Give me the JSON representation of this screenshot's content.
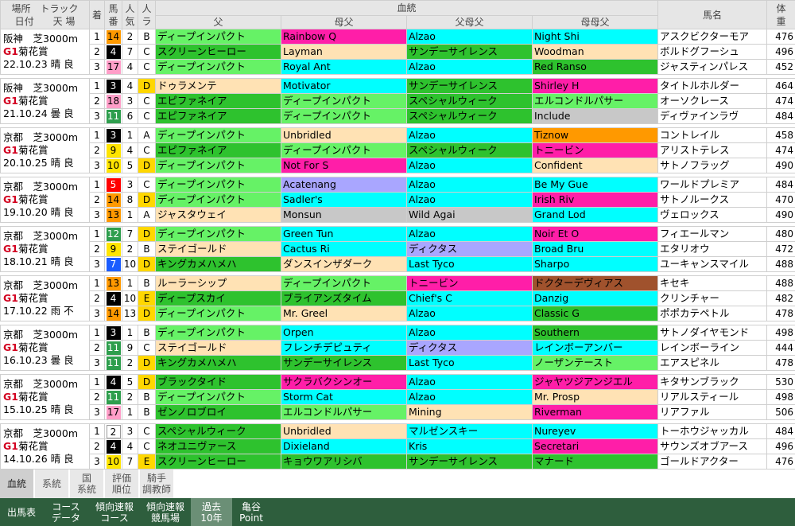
{
  "headers": {
    "place": "場所",
    "track": "トラック",
    "date": "日付",
    "weather_ground": "天 場",
    "finish": "着",
    "horse_no": "馬番",
    "popularity": "人気",
    "rank": "人ラ",
    "pedigree": "血統",
    "sire": "父",
    "damsire": "母父",
    "sire_sire": "父母父",
    "dam_dam_sire": "母母父",
    "horse_name": "馬名",
    "weight": "体重"
  },
  "colors": {
    "green": "#66f266",
    "dkgreen": "#2ec22e",
    "magenta": "#ff1ea8",
    "cyan": "#00ffff",
    "peach": "#ffe2b4",
    "purple": "#a9a6ff",
    "grey": "#c8c8c8",
    "orange": "#ff9900",
    "brown": "#a0522d",
    "frame_gray": "#bfbfbf"
  },
  "races": [
    {
      "place": "阪神",
      "track": "芝3000m",
      "grade": "G1",
      "race": "菊花賞",
      "date": "22.10.23",
      "weather": "晴",
      "ground": "良",
      "horses": [
        {
          "finish": "1",
          "no": "14",
          "frame": "orange",
          "pop": "2",
          "rank": "B",
          "sire": "ディープインパクト",
          "sire_c": "green",
          "dams": "Rainbow Q",
          "dams_c": "magenta",
          "ss": "Alzao",
          "ss_c": "cyan",
          "dds": "Night Shi",
          "dds_c": "cyan",
          "name": "アスクビクターモア",
          "weight": "476"
        },
        {
          "finish": "2",
          "no": "4",
          "frame": "black",
          "pop": "7",
          "rank": "C",
          "sire": "スクリーンヒーロー",
          "sire_c": "dkgreen",
          "dams": "Layman",
          "dams_c": "peach",
          "ss": "サンデーサイレンス",
          "ss_c": "dkgreen",
          "dds": "Woodman",
          "dds_c": "peach",
          "name": "ボルドグフーシュ",
          "weight": "496"
        },
        {
          "finish": "3",
          "no": "17",
          "frame": "pink",
          "pop": "4",
          "rank": "C",
          "sire": "ディープインパクト",
          "sire_c": "green",
          "dams": "Royal Ant",
          "dams_c": "cyan",
          "ss": "Alzao",
          "ss_c": "cyan",
          "dds": "Red Ranso",
          "dds_c": "dkgreen",
          "name": "ジャスティンパレス",
          "weight": "452"
        }
      ]
    },
    {
      "place": "阪神",
      "track": "芝3000m",
      "grade": "G1",
      "race": "菊花賞",
      "date": "21.10.24",
      "weather": "曇",
      "ground": "良",
      "horses": [
        {
          "finish": "1",
          "no": "3",
          "frame": "black",
          "pop": "4",
          "rank": "D",
          "sire": "ドゥラメンテ",
          "sire_c": "peach",
          "dams": "Motivator",
          "dams_c": "cyan",
          "ss": "サンデーサイレンス",
          "ss_c": "dkgreen",
          "dds": "Shirley H",
          "dds_c": "magenta",
          "name": "タイトルホルダー",
          "weight": "464"
        },
        {
          "finish": "2",
          "no": "18",
          "frame": "pink",
          "pop": "3",
          "rank": "C",
          "sire": "エピファネイア",
          "sire_c": "dkgreen",
          "dams": "ディープインパクト",
          "dams_c": "green",
          "ss": "スペシャルウィーク",
          "ss_c": "dkgreen",
          "dds": "エルコンドルパサー",
          "dds_c": "green",
          "name": "オーソクレース",
          "weight": "474"
        },
        {
          "finish": "3",
          "no": "11",
          "frame": "green",
          "pop": "6",
          "rank": "C",
          "sire": "エピファネイア",
          "sire_c": "dkgreen",
          "dams": "ディープインパクト",
          "dams_c": "green",
          "ss": "スペシャルウィーク",
          "ss_c": "dkgreen",
          "dds": "Include",
          "dds_c": "grey",
          "name": "ディヴァインラヴ",
          "weight": "484"
        }
      ]
    },
    {
      "place": "京都",
      "track": "芝3000m",
      "grade": "G1",
      "race": "菊花賞",
      "date": "20.10.25",
      "weather": "晴",
      "ground": "良",
      "horses": [
        {
          "finish": "1",
          "no": "3",
          "frame": "black",
          "pop": "1",
          "rank": "A",
          "sire": "ディープインパクト",
          "sire_c": "green",
          "dams": "Unbridled",
          "dams_c": "peach",
          "ss": "Alzao",
          "ss_c": "cyan",
          "dds": "Tiznow",
          "dds_c": "orange",
          "name": "コントレイル",
          "weight": "458"
        },
        {
          "finish": "2",
          "no": "9",
          "frame": "yellow",
          "pop": "4",
          "rank": "C",
          "sire": "エピファネイア",
          "sire_c": "dkgreen",
          "dams": "ディープインパクト",
          "dams_c": "green",
          "ss": "スペシャルウィーク",
          "ss_c": "dkgreen",
          "dds": "トニービン",
          "dds_c": "magenta",
          "name": "アリストテレス",
          "weight": "474"
        },
        {
          "finish": "3",
          "no": "10",
          "frame": "yellow",
          "pop": "5",
          "rank": "D",
          "sire": "ディープインパクト",
          "sire_c": "green",
          "dams": "Not For S",
          "dams_c": "magenta",
          "ss": "Alzao",
          "ss_c": "cyan",
          "dds": "Confident",
          "dds_c": "peach",
          "name": "サトノフラッグ",
          "weight": "490"
        }
      ]
    },
    {
      "place": "京都",
      "track": "芝3000m",
      "grade": "G1",
      "race": "菊花賞",
      "date": "19.10.20",
      "weather": "晴",
      "ground": "良",
      "horses": [
        {
          "finish": "1",
          "no": "5",
          "frame": "red",
          "pop": "3",
          "rank": "C",
          "sire": "ディープインパクト",
          "sire_c": "green",
          "dams": "Acatenang",
          "dams_c": "purple",
          "ss": "Alzao",
          "ss_c": "cyan",
          "dds": "Be My Gue",
          "dds_c": "cyan",
          "name": "ワールドプレミア",
          "weight": "484"
        },
        {
          "finish": "2",
          "no": "14",
          "frame": "orange",
          "pop": "8",
          "rank": "D",
          "sire": "ディープインパクト",
          "sire_c": "green",
          "dams": "Sadler's",
          "dams_c": "cyan",
          "ss": "Alzao",
          "ss_c": "cyan",
          "dds": "Irish Riv",
          "dds_c": "magenta",
          "name": "サトノルークス",
          "weight": "470"
        },
        {
          "finish": "3",
          "no": "13",
          "frame": "orange",
          "pop": "1",
          "rank": "A",
          "sire": "ジャスタウェイ",
          "sire_c": "peach",
          "dams": "Monsun",
          "dams_c": "grey",
          "ss": "Wild Agai",
          "ss_c": "grey",
          "dds": "Grand Lod",
          "dds_c": "cyan",
          "name": "ヴェロックス",
          "weight": "490"
        }
      ]
    },
    {
      "place": "京都",
      "track": "芝3000m",
      "grade": "G1",
      "race": "菊花賞",
      "date": "18.10.21",
      "weather": "晴",
      "ground": "良",
      "horses": [
        {
          "finish": "1",
          "no": "12",
          "frame": "green",
          "pop": "7",
          "rank": "D",
          "sire": "ディープインパクト",
          "sire_c": "green",
          "dams": "Green Tun",
          "dams_c": "cyan",
          "ss": "Alzao",
          "ss_c": "cyan",
          "dds": "Noir Et O",
          "dds_c": "magenta",
          "name": "フィエールマン",
          "weight": "480"
        },
        {
          "finish": "2",
          "no": "9",
          "frame": "yellow",
          "pop": "2",
          "rank": "B",
          "sire": "ステイゴールド",
          "sire_c": "peach",
          "dams": "Cactus Ri",
          "dams_c": "cyan",
          "ss": "ディクタス",
          "ss_c": "purple",
          "dds": "Broad Bru",
          "dds_c": "cyan",
          "name": "エタリオウ",
          "weight": "472"
        },
        {
          "finish": "3",
          "no": "7",
          "frame": "blue",
          "pop": "10",
          "rank": "D",
          "sire": "キングカメハメハ",
          "sire_c": "dkgreen",
          "dams": "ダンスインザダーク",
          "dams_c": "peach",
          "ss": "Last Tyco",
          "ss_c": "cyan",
          "dds": "Sharpo",
          "dds_c": "cyan",
          "name": "ユーキャンスマイル",
          "weight": "488"
        }
      ]
    },
    {
      "place": "京都",
      "track": "芝3000m",
      "grade": "G1",
      "race": "菊花賞",
      "date": "17.10.22",
      "weather": "雨",
      "ground": "不",
      "horses": [
        {
          "finish": "1",
          "no": "13",
          "frame": "orange",
          "pop": "1",
          "rank": "B",
          "sire": "ルーラーシップ",
          "sire_c": "peach",
          "dams": "ディープインパクト",
          "dams_c": "green",
          "ss": "トニービン",
          "ss_c": "magenta",
          "dds": "ドクターデヴィアス",
          "dds_c": "brown",
          "name": "キセキ",
          "weight": "488"
        },
        {
          "finish": "2",
          "no": "4",
          "frame": "black",
          "pop": "10",
          "rank": "E",
          "sire": "ディープスカイ",
          "sire_c": "dkgreen",
          "dams": "ブライアンズタイム",
          "dams_c": "dkgreen",
          "ss": "Chief's C",
          "ss_c": "cyan",
          "dds": "Danzig",
          "dds_c": "cyan",
          "name": "クリンチャー",
          "weight": "482"
        },
        {
          "finish": "3",
          "no": "14",
          "frame": "orange",
          "pop": "13",
          "rank": "D",
          "sire": "ディープインパクト",
          "sire_c": "green",
          "dams": "Mr. Greel",
          "dams_c": "peach",
          "ss": "Alzao",
          "ss_c": "cyan",
          "dds": "Classic G",
          "dds_c": "dkgreen",
          "name": "ポポカテペトル",
          "weight": "478"
        }
      ]
    },
    {
      "place": "京都",
      "track": "芝3000m",
      "grade": "G1",
      "race": "菊花賞",
      "date": "16.10.23",
      "weather": "曇",
      "ground": "良",
      "horses": [
        {
          "finish": "1",
          "no": "3",
          "frame": "black",
          "pop": "1",
          "rank": "B",
          "sire": "ディープインパクト",
          "sire_c": "green",
          "dams": "Orpen",
          "dams_c": "cyan",
          "ss": "Alzao",
          "ss_c": "cyan",
          "dds": "Southern",
          "dds_c": "dkgreen",
          "name": "サトノダイヤモンド",
          "weight": "498"
        },
        {
          "finish": "2",
          "no": "11",
          "frame": "green",
          "pop": "9",
          "rank": "C",
          "sire": "ステイゴールド",
          "sire_c": "peach",
          "dams": "フレンチデピュティ",
          "dams_c": "cyan",
          "ss": "ディクタス",
          "ss_c": "purple",
          "dds": "レインボーアンバー",
          "dds_c": "cyan",
          "name": "レインボーライン",
          "weight": "444"
        },
        {
          "finish": "3",
          "no": "11",
          "frame": "green",
          "pop": "2",
          "rank": "D",
          "sire": "キングカメハメハ",
          "sire_c": "dkgreen",
          "dams": "サンデーサイレンス",
          "dams_c": "dkgreen",
          "ss": "Last Tyco",
          "ss_c": "cyan",
          "dds": "ノーザンテースト",
          "dds_c": "green",
          "name": "エアスピネル",
          "weight": "478"
        }
      ]
    },
    {
      "place": "京都",
      "track": "芝3000m",
      "grade": "G1",
      "race": "菊花賞",
      "date": "15.10.25",
      "weather": "晴",
      "ground": "良",
      "horses": [
        {
          "finish": "1",
          "no": "4",
          "frame": "black",
          "pop": "5",
          "rank": "D",
          "sire": "ブラックタイド",
          "sire_c": "dkgreen",
          "dams": "サクラバクシンオー",
          "dams_c": "magenta",
          "ss": "Alzao",
          "ss_c": "cyan",
          "dds": "ジャヤツジアンジエル",
          "dds_c": "magenta",
          "name": "キタサンブラック",
          "weight": "530"
        },
        {
          "finish": "2",
          "no": "11",
          "frame": "green",
          "pop": "2",
          "rank": "B",
          "sire": "ディープインパクト",
          "sire_c": "green",
          "dams": "Storm Cat",
          "dams_c": "cyan",
          "ss": "Alzao",
          "ss_c": "cyan",
          "dds": "Mr. Prosp",
          "dds_c": "peach",
          "name": "リアルスティール",
          "weight": "498"
        },
        {
          "finish": "3",
          "no": "17",
          "frame": "pink",
          "pop": "1",
          "rank": "B",
          "sire": "ゼンノロブロイ",
          "sire_c": "dkgreen",
          "dams": "エルコンドルパサー",
          "dams_c": "green",
          "ss": "Mining",
          "ss_c": "peach",
          "dds": "Riverman",
          "dds_c": "magenta",
          "name": "リアファル",
          "weight": "506"
        }
      ]
    },
    {
      "place": "京都",
      "track": "芝3000m",
      "grade": "G1",
      "race": "菊花賞",
      "date": "14.10.26",
      "weather": "晴",
      "ground": "良",
      "horses": [
        {
          "finish": "1",
          "no": "2",
          "frame": "white",
          "pop": "3",
          "rank": "C",
          "sire": "スペシャルウィーク",
          "sire_c": "dkgreen",
          "dams": "Unbridled",
          "dams_c": "peach",
          "ss": "マルゼンスキー",
          "ss_c": "cyan",
          "dds": "Nureyev",
          "dds_c": "cyan",
          "name": "トーホウジャッカル",
          "weight": "484"
        },
        {
          "finish": "2",
          "no": "4",
          "frame": "black",
          "pop": "4",
          "rank": "C",
          "sire": "ネオユニヴァース",
          "sire_c": "dkgreen",
          "dams": "Dixieland",
          "dams_c": "cyan",
          "ss": "Kris",
          "ss_c": "cyan",
          "dds": "Secretari",
          "dds_c": "magenta",
          "name": "サウンズオブアース",
          "weight": "496"
        },
        {
          "finish": "3",
          "no": "10",
          "frame": "yellow",
          "pop": "7",
          "rank": "E",
          "sire": "スクリーンヒーロー",
          "sire_c": "dkgreen",
          "dams": "キョウワアリシバ",
          "dams_c": "dkgreen",
          "ss": "サンデーサイレンス",
          "ss_c": "dkgreen",
          "dds": "マナード",
          "dds_c": "dkgreen",
          "name": "ゴールドアクター",
          "weight": "476"
        }
      ]
    }
  ],
  "tabs": [
    {
      "label": "血統",
      "active": true
    },
    {
      "label": "系統",
      "active": false
    },
    {
      "label": "国\n系統",
      "active": false
    },
    {
      "label": "評価\n順位",
      "active": false
    },
    {
      "label": "騎手\n調教師",
      "active": false
    }
  ],
  "bottom_nav": [
    {
      "label": "出馬表",
      "active": false
    },
    {
      "label": "コース\nデータ",
      "active": false
    },
    {
      "label": "傾向速報\nコース",
      "active": false
    },
    {
      "label": "傾向速報\n競馬場",
      "active": false
    },
    {
      "label": "過去\n10年",
      "active": true
    },
    {
      "label": "亀谷\nPoint",
      "active": false
    }
  ]
}
